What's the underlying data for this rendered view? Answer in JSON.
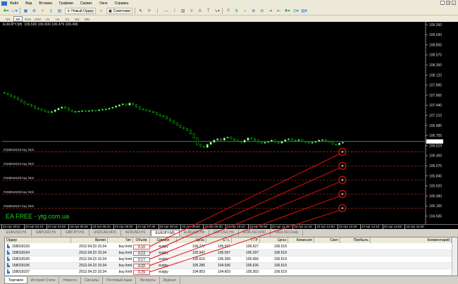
{
  "menu": [
    "Файл",
    "Вид",
    "Вставка",
    "Графики",
    "Сервис",
    "Окно",
    "Справка"
  ],
  "toolbar": {
    "new_order": "Новый Ордер",
    "advisors": "Советники"
  },
  "timeframes": [
    "M1",
    "M5",
    "M15",
    "M30",
    "H1",
    "H4",
    "D1",
    "W1",
    "MN"
  ],
  "active_timeframe": "M5",
  "chart": {
    "header": "EURJPY,M5  106.500 106.500 106.479 106.496",
    "watermark": "EA FREE - ytg.com.ua",
    "bid": 106.519,
    "price_range": [
      104.53,
      109.26
    ],
    "price_labels": [
      "109.260",
      "109.030",
      "108.805",
      "108.575",
      "108.350",
      "108.120",
      "107.895",
      "107.665",
      "107.440",
      "107.210",
      "106.985",
      "106.755",
      "106.519",
      "106.300",
      "106.075",
      "105.845",
      "105.620",
      "105.390",
      "105.165",
      "104.935",
      "104.710"
    ],
    "time_labels": [
      "23 Apr 2012",
      "23 Apr 04:10",
      "23 Apr 04:50",
      "23 Apr 05:30",
      "23 Apr 06:10",
      "23 Apr 06:50",
      "23 Apr 07:30",
      "23 Apr 08:10",
      "23 Apr 08:50",
      "23 Apr 09:30",
      "23 Apr 10:10",
      "23 Apr 10:50",
      "23 Apr 11:30",
      "23 Apr 12:10",
      "23 Apr 12:50",
      "23 Apr 13:30",
      "23 Apr 14:10",
      "23 Apr 14:50",
      "23 Apr 15:30"
    ],
    "closes": [
      107.65,
      107.62,
      107.58,
      107.55,
      107.5,
      107.45,
      107.4,
      107.38,
      107.35,
      107.3,
      107.28,
      107.25,
      107.22,
      107.2,
      107.22,
      107.26,
      107.3,
      107.33,
      107.3,
      107.25,
      107.22,
      107.22,
      107.23,
      107.24,
      107.23,
      107.24,
      107.25,
      107.24,
      107.26,
      107.27,
      107.28,
      107.3,
      107.32,
      107.35,
      107.38,
      107.4,
      107.37,
      107.42,
      107.38,
      107.33,
      107.28,
      107.26,
      107.25,
      107.22,
      107.2,
      107.15,
      107.12,
      107.1,
      107.05,
      107.0,
      106.95,
      106.9,
      106.85,
      106.82,
      106.78,
      106.7,
      106.6,
      106.45,
      106.4,
      106.38,
      106.45,
      106.5,
      106.55,
      106.58,
      106.55,
      106.6,
      106.62,
      106.58,
      106.55,
      106.52,
      106.5,
      106.55,
      106.6,
      106.58,
      106.55,
      106.5,
      106.48,
      106.5,
      106.52,
      106.55,
      106.5,
      106.48,
      106.52,
      106.56,
      106.58,
      106.55,
      106.54,
      106.56,
      106.52,
      106.5,
      106.48,
      106.5,
      106.52,
      106.55,
      106.56,
      106.53,
      106.5,
      106.46,
      106.44,
      106.48,
      106.5
    ],
    "colors": {
      "candle": "#00c800",
      "order_line": "#b03020",
      "annotation": "#e01010",
      "bid_line": "#8090a0",
      "watermark": "#20d020"
    }
  },
  "chart_tabs": [
    "EURUSD,H1",
    "GBPUSD,H1",
    "GBPJPY,H1",
    "USDCAD,M15",
    "NZDUSD,H1",
    "EURJPY,M5",
    "EURUSD,H4",
    "GBPUSD,H4",
    "EURUSD,M30",
    "XAUUSD,Daily"
  ],
  "active_chart_tab": "EURJPY,M5",
  "table": {
    "columns": [
      "Ордер",
      "Время",
      "Тип",
      "Объём",
      "Символ",
      "Цена",
      "S / L",
      "T / P",
      "Цена",
      "Комиссия",
      "Своп",
      "Прибыль",
      "Комментарий"
    ],
    "rows": [
      {
        "order": "158018103",
        "time": "2012.04.23 15:34",
        "type": "buy limit",
        "volume": "0.10",
        "symbol": "eurjpy",
        "price": "106.277",
        "sl": "105.927",
        "tp": "106.627",
        "cur": "106.519",
        "label": "#158018103 buy limit"
      },
      {
        "order": "158018104",
        "time": "2012.04.23 15:34",
        "type": "buy limit",
        "volume": "0.13",
        "symbol": "eurjpy",
        "price": "105.947",
        "sl": "105.597",
        "tp": "106.297",
        "cur": "106.519",
        "label": "#158018104 buy limit"
      },
      {
        "order": "158018105",
        "time": "2012.04.23 15:34",
        "type": "buy limit",
        "volume": "0.17",
        "symbol": "eurjpy",
        "price": "105.616",
        "sl": "105.266",
        "tp": "105.966",
        "cur": "106.519",
        "label": "#158018105 buy limit"
      },
      {
        "order": "158018106",
        "time": "2012.04.23 15:34",
        "type": "buy limit",
        "volume": "0.22",
        "symbol": "eurjpy",
        "price": "105.286",
        "sl": "104.936",
        "tp": "105.636",
        "cur": "106.519",
        "label": "#158018106 buy limit"
      },
      {
        "order": "158018107",
        "time": "2012.04.23 15:34",
        "type": "buy limit",
        "volume": "0.29",
        "symbol": "eurjpy",
        "price": "104.953",
        "sl": "104.603",
        "tp": "105.303",
        "cur": "106.519",
        "label": "#158018107 buy limit"
      }
    ]
  },
  "bottom_tabs": [
    "Торговля",
    "История Счета",
    "Новости",
    "Сигналы",
    "Почтовый ящик",
    "Эксперты",
    "Журнал"
  ],
  "active_bottom_tab": "Торговля"
}
